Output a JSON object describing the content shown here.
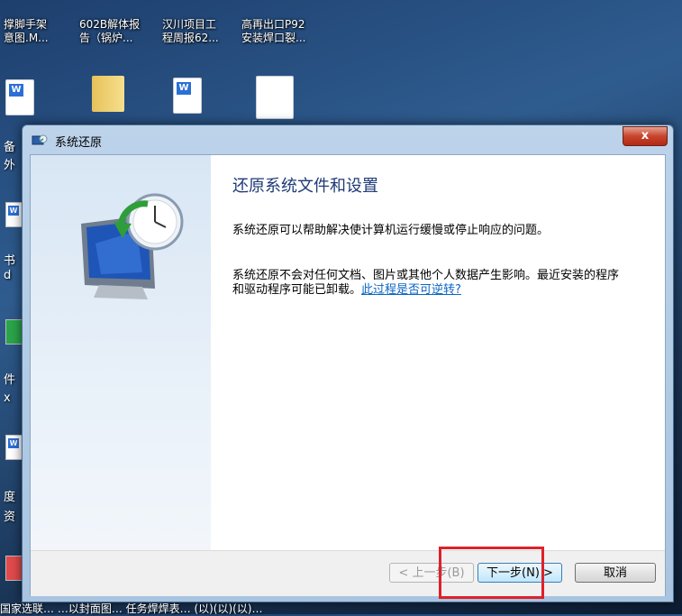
{
  "desktop": {
    "top_icons": [
      {
        "line1": "撑脚手架",
        "line2": "意图.M..."
      },
      {
        "line1": "602B解体报",
        "line2": "告（锅炉..."
      },
      {
        "line1": "汉川项目工",
        "line2": "程周报62..."
      },
      {
        "line1": "高再出口P92",
        "line2": "安装焊口裂..."
      }
    ],
    "left_labels": [
      "备",
      "外",
      "书",
      "d",
      "件",
      "x",
      "度",
      "资"
    ],
    "taskbar_text": "国家选联…  …以封面图…  任务焊焊表…  (以)(以)(以)…"
  },
  "window": {
    "title": "系统还原",
    "close_label": "x",
    "heading": "还原系统文件和设置",
    "paragraph1": "系统还原可以帮助解决使计算机运行缓慢或停止响应的问题。",
    "paragraph2": "系统还原不会对任何文档、图片或其他个人数据产生影响。最近安装的程序和驱动程序可能已卸载。",
    "link_text": "此过程是否可逆转?",
    "buttons": {
      "back": "< 上一步(B)",
      "next": "下一步(N) >",
      "cancel": "取消"
    }
  }
}
